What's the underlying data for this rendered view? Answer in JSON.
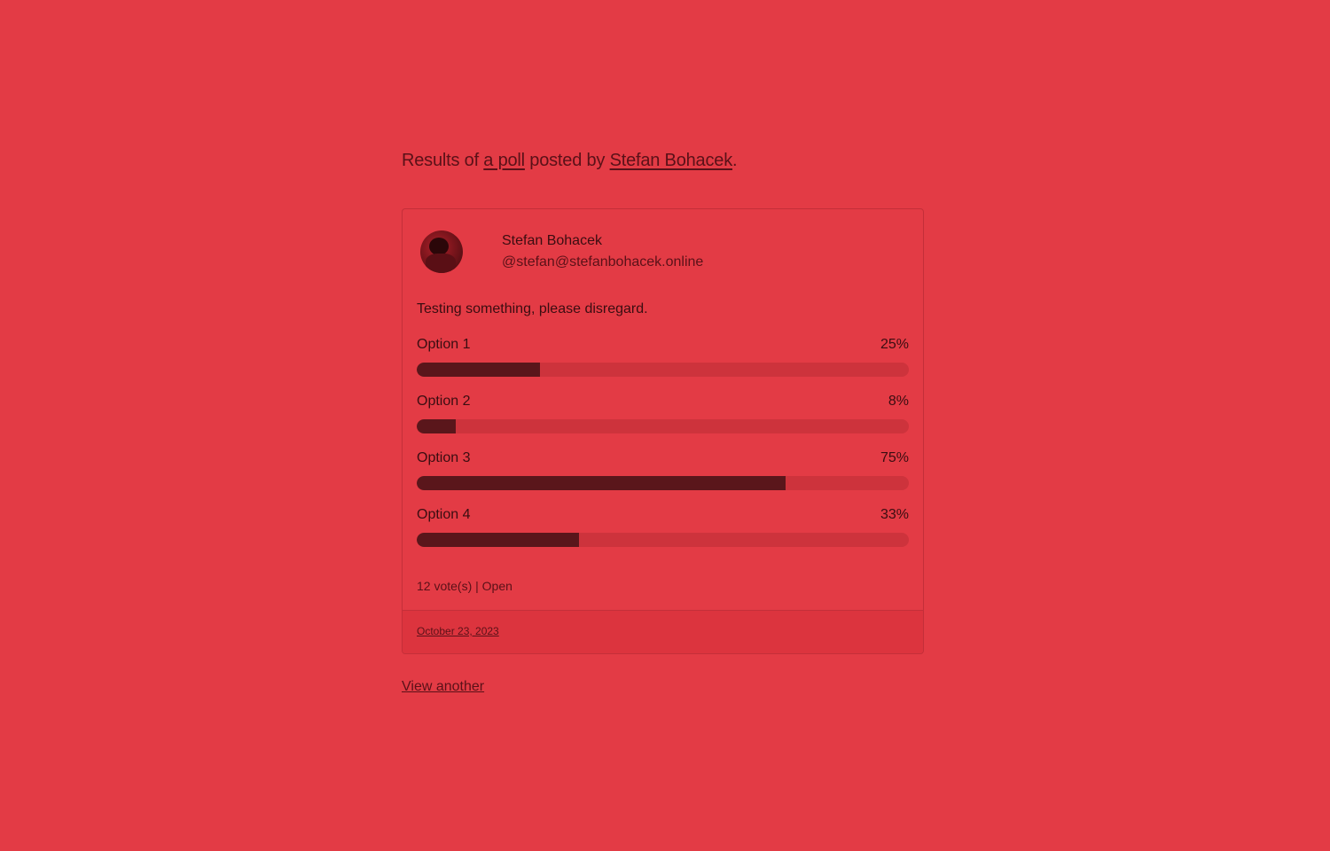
{
  "intro": {
    "prefix": "Results of ",
    "poll_link": "a poll",
    "middle": " posted by ",
    "author_link": "Stefan Bohacek",
    "suffix": "."
  },
  "post": {
    "author_name": "Stefan Bohacek",
    "author_handle": "@stefan@stefanbohacek.online",
    "avatar_icon": "user-avatar",
    "text": "Testing something, please disregard.",
    "options": [
      {
        "label": "Option 1",
        "percent_label": "25%",
        "percent": 25
      },
      {
        "label": "Option 2",
        "percent_label": "8%",
        "percent": 8
      },
      {
        "label": "Option 3",
        "percent_label": "75%",
        "percent": 75
      },
      {
        "label": "Option 4",
        "percent_label": "33%",
        "percent": 33
      }
    ],
    "meta": "12 vote(s) | Open",
    "date": "October 23, 2023"
  },
  "view_another": "View another",
  "colors": {
    "background": "#e33b45",
    "bar_fill": "#5a161b",
    "bar_track": "#cd333c"
  }
}
